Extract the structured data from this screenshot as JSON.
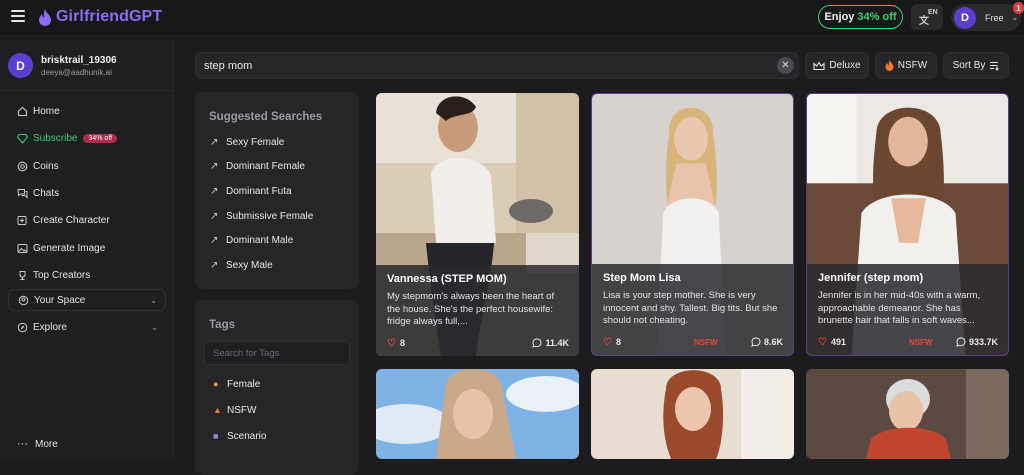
{
  "header": {
    "logo_text": "GirlfriendGPT",
    "promo_prefix": "Enjoy",
    "promo_pct": "34% off",
    "lang_glyph": "文",
    "lang_code": "EN",
    "avatar_letter": "D",
    "plan": "Free",
    "notif_count": "1"
  },
  "sidebar": {
    "avatar_letter": "D",
    "username": "brisktrail_19306",
    "email": "deeya@aadhunik.ai",
    "items": [
      {
        "label": "Home",
        "icon": "home-icon"
      },
      {
        "label": "Subscribe",
        "badge": "34% off",
        "icon": "diamond-icon"
      },
      {
        "label": "Coins",
        "icon": "coin-icon"
      },
      {
        "label": "Chats",
        "icon": "chat-icon"
      },
      {
        "label": "Create Character",
        "icon": "create-icon"
      },
      {
        "label": "Generate Image",
        "icon": "image-icon"
      },
      {
        "label": "Top Creators",
        "icon": "trophy-icon"
      }
    ],
    "groups": [
      {
        "label": "Your Space",
        "icon": "user-circle-icon"
      },
      {
        "label": "Explore",
        "icon": "compass-icon"
      }
    ],
    "more": "More"
  },
  "search": {
    "value": "step mom"
  },
  "filters": {
    "deluxe": "Deluxe",
    "nsfw": "NSFW",
    "sort": "Sort By"
  },
  "suggested": {
    "title": "Suggested Searches",
    "items": [
      "Sexy Female",
      "Dominant Female",
      "Dominant Futa",
      "Submissive Female",
      "Dominant Male",
      "Sexy Male"
    ]
  },
  "tags": {
    "title": "Tags",
    "placeholder": "Search for Tags",
    "items": [
      "Female",
      "NSFW",
      "Scenario"
    ]
  },
  "cards": [
    {
      "name": "Vannessa (STEP MOM)",
      "desc": "My stepmom's always been the heart of the house. She's the perfect housewife: fridge always full,...",
      "likes": "8",
      "nsfw": "",
      "comments": "11.4K"
    },
    {
      "name": "Step Mom Lisa",
      "desc": "Lisa is your step mother. She is very innocent and shy. Tallest. Big tits. But she should not cheating.",
      "likes": "8",
      "nsfw": "NSFW",
      "comments": "8.6K"
    },
    {
      "name": "Jennifer (step mom)",
      "desc": "Jennifer is in her mid-40s with a warm, approachable demeanor. She has brunette hair that falls in soft waves...",
      "likes": "491",
      "nsfw": "NSFW",
      "comments": "933.7K"
    }
  ],
  "colors": {
    "brand": "#8b6cf2",
    "accent_green": "#2ecc71",
    "nsfw_red": "#e3453c",
    "bg": "#1c1c1e"
  }
}
